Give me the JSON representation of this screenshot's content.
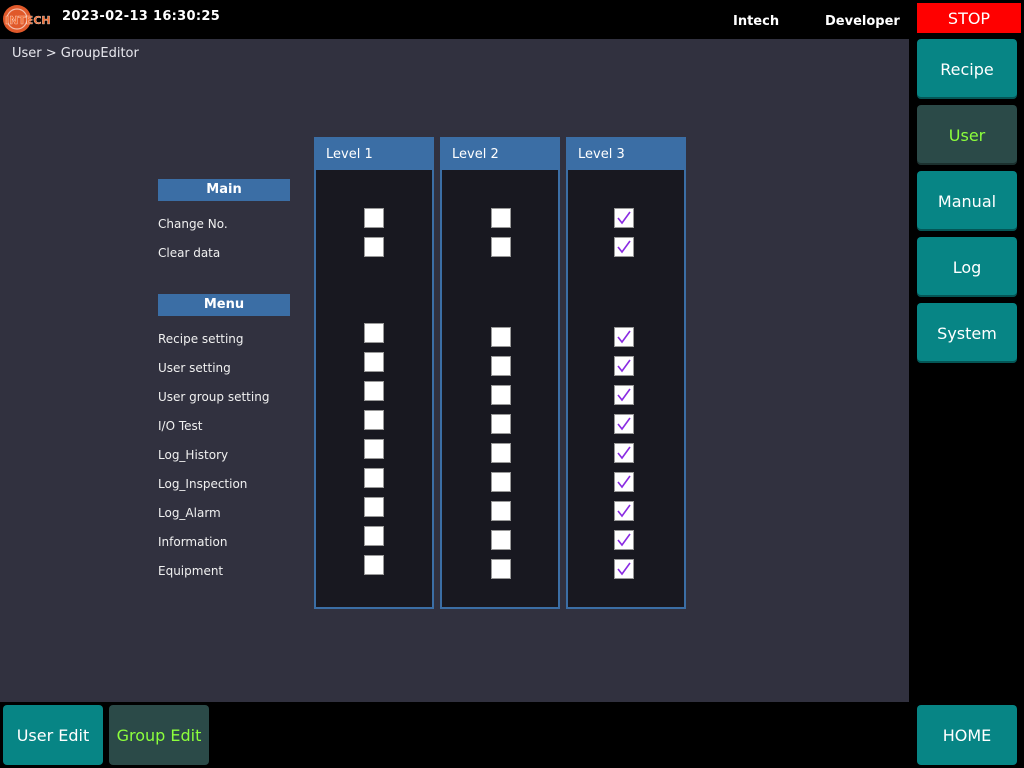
{
  "header": {
    "datetime": "2023-02-13 16:30:25",
    "company": "Intech",
    "user": "Developer",
    "stop_label": "STOP",
    "logo_icon": "intech-logo-icon",
    "logo_text": "INTECH"
  },
  "breadcrumb": "User > GroupEditor",
  "levels": [
    "Level 1",
    "Level 2",
    "Level 3"
  ],
  "sections": {
    "main": {
      "title": "Main",
      "rows": [
        {
          "label": "Change No.",
          "checked": [
            false,
            false,
            true
          ]
        },
        {
          "label": "Clear data",
          "checked": [
            false,
            false,
            true
          ]
        }
      ]
    },
    "menu": {
      "title": "Menu",
      "rows": [
        {
          "label": "Recipe setting",
          "checked": [
            false,
            false,
            true
          ]
        },
        {
          "label": "User setting",
          "checked": [
            false,
            false,
            true
          ]
        },
        {
          "label": "User group setting",
          "checked": [
            false,
            false,
            true
          ]
        },
        {
          "label": "I/O Test",
          "checked": [
            false,
            false,
            true
          ]
        },
        {
          "label": "Log_History",
          "checked": [
            false,
            false,
            true
          ]
        },
        {
          "label": "Log_Inspection",
          "checked": [
            false,
            false,
            true
          ]
        },
        {
          "label": "Log_Alarm",
          "checked": [
            false,
            false,
            true
          ]
        },
        {
          "label": "Information",
          "checked": [
            false,
            false,
            true
          ]
        },
        {
          "label": "Equipment",
          "checked": [
            false,
            false,
            true
          ]
        }
      ]
    }
  },
  "sidebar": [
    {
      "label": "Recipe",
      "active": false
    },
    {
      "label": "User",
      "active": true
    },
    {
      "label": "Manual",
      "active": false
    },
    {
      "label": "Log",
      "active": false
    },
    {
      "label": "System",
      "active": false
    }
  ],
  "bottom": {
    "user_edit": "User Edit",
    "group_edit": "Group Edit",
    "home": "HOME"
  },
  "colors": {
    "accent_blue": "#3b6ea5",
    "teal_button": "#078585",
    "active_text": "#8cff3c",
    "stop_red": "#ff0000",
    "check_purple": "#8a2be2"
  }
}
